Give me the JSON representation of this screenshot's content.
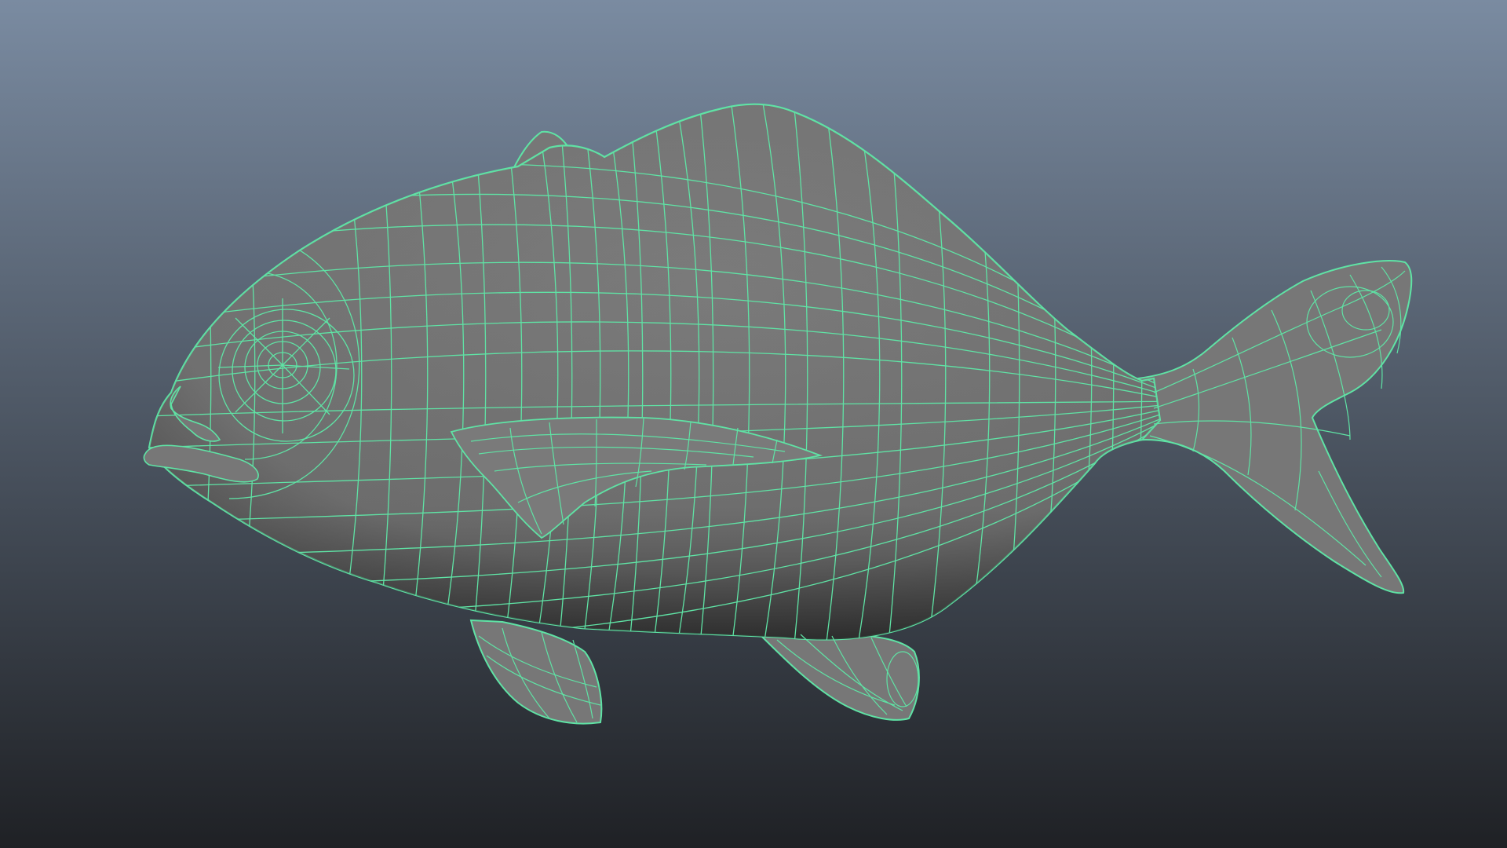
{
  "viewport": {
    "background_top": "#7a8ba1",
    "background_bottom": "#1f2125",
    "wireframe_color": "#5fe3a5",
    "surface_color": "#777777",
    "surface_shadow": "#3e3e3e"
  }
}
